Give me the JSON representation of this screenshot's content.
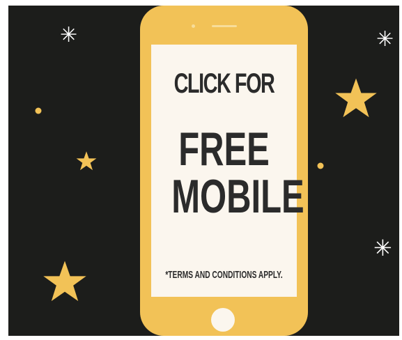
{
  "ad": {
    "line1": "CLICK FOR",
    "line2": "FREE",
    "line3": "MOBILE",
    "terms": "*TERMS AND CONDITIONS APPLY."
  },
  "icons": {
    "star": "star-icon",
    "sparkle": "sparkle-icon",
    "dot": "dot-icon",
    "sparkle_glyph": "✳"
  },
  "colors": {
    "background": "#1c1d1b",
    "phone": "#f2c257",
    "screen": "#fbf6ee",
    "text": "#2b2b2b",
    "star": "#f2c257",
    "sparkle": "#ffffff"
  }
}
